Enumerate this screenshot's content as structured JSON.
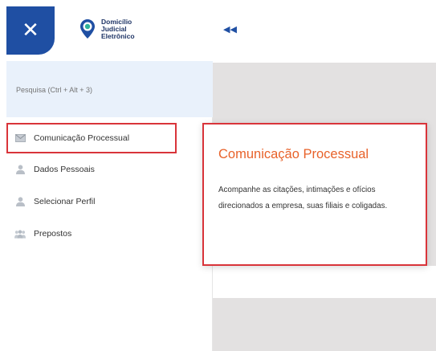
{
  "header": {
    "close_icon": "close-icon",
    "collapse_icon": "double-chevron-left-icon",
    "logo": {
      "line1": "Domicílio",
      "line2": "Judicial",
      "line3": "Eletrônico",
      "brand_color": "#1f4fa3"
    }
  },
  "search": {
    "placeholder": "Pesquisa (Ctrl + Alt + 3)"
  },
  "sidebar": {
    "items": [
      {
        "label": "Comunicação Processual",
        "icon": "mail-icon",
        "active": true
      },
      {
        "label": "Dados Pessoais",
        "icon": "person-icon",
        "active": false
      },
      {
        "label": "Selecionar Perfil",
        "icon": "person-icon",
        "active": false
      },
      {
        "label": "Prepostos",
        "icon": "group-icon",
        "active": false
      }
    ]
  },
  "popover": {
    "title": "Comunicação Processual",
    "body": "Acompanhe as citações, intimações e ofícios direcionados a empresa, suas filiais e coligadas."
  },
  "colors": {
    "accent": "#1f4fa3",
    "highlight_border": "#d9343a",
    "popover_title": "#e8622a"
  }
}
